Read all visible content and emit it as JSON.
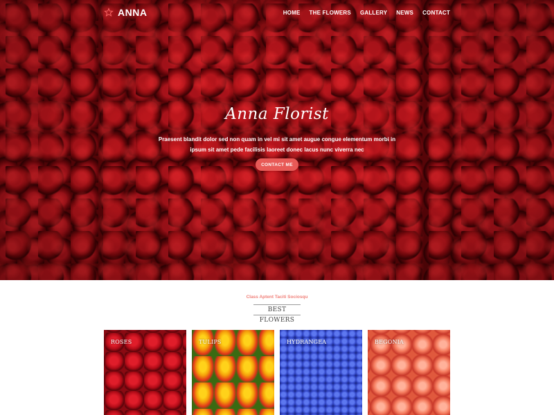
{
  "header": {
    "brand_name": "ANNA",
    "nav": [
      {
        "label": "HOME"
      },
      {
        "label": "THE FLOWERS"
      },
      {
        "label": "GALLERY"
      },
      {
        "label": "NEWS"
      },
      {
        "label": "CONTACT"
      }
    ]
  },
  "hero": {
    "title": "Anna Florist",
    "text": "Praesent blandit dolor sed non quam in vel mi sit amet augue congue elementum morbi in ipsum sit amet pede facilisis laoreet donec lacus nunc viverra nec",
    "cta_label": "CONTACT ME"
  },
  "section": {
    "kicker": "Class Aptent Taciti Sociosqu",
    "title": "BEST FLOWERS"
  },
  "cards": [
    {
      "label": "ROSES"
    },
    {
      "label": "TULIPS"
    },
    {
      "label": "HYDRANGEA"
    },
    {
      "label": "BEGONIA"
    }
  ],
  "colors": {
    "accent": "#e85a57",
    "kicker": "#f07f78"
  },
  "icons": {
    "brand": "flower-outline-icon"
  }
}
